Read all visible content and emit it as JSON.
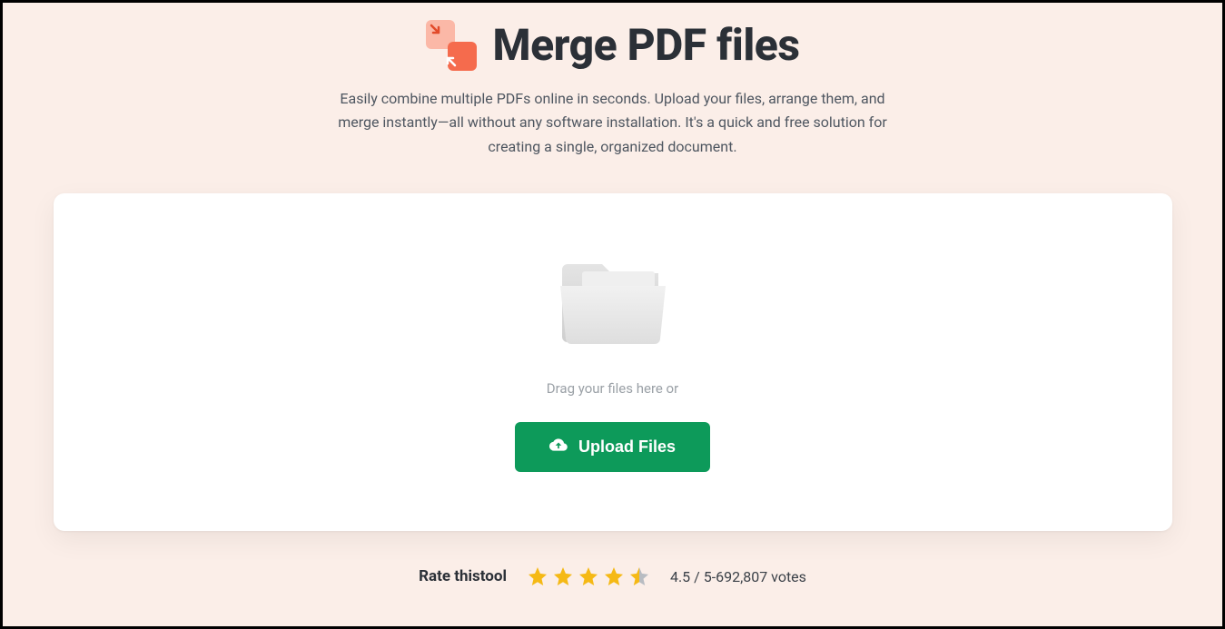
{
  "hero": {
    "title": "Merge PDF files",
    "subtitle": "Easily combine multiple PDFs online in seconds. Upload your files, arrange them, and merge instantly—all without any software installation. It's a quick and free solution for creating a single, organized document."
  },
  "upload": {
    "drag_text": "Drag your files here or",
    "button_label": "Upload Files"
  },
  "rating": {
    "label": "Rate thistool",
    "score_text": "4.5 / 5-692,807 votes",
    "value": 4.5,
    "max": 5,
    "votes": 692807
  }
}
